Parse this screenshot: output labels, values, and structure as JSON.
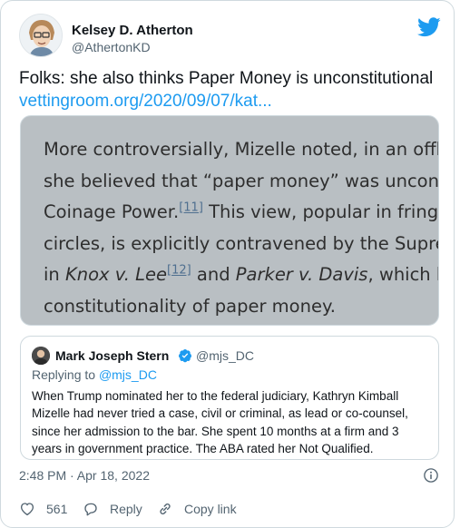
{
  "author": {
    "name": "Kelsey D. Atherton",
    "handle": "@AthertonKD"
  },
  "tweet": {
    "text": "Folks: she also thinks Paper Money is unconstitutional",
    "link": "vettingroom.org/2020/09/07/kat..."
  },
  "media": {
    "lines": [
      "More controversially, Mizelle noted, in an offhar",
      "she believed that “paper money” was unconstit",
      "Coinage Power.",
      "circles, is explicitly contravened by the Supremo",
      "in ",
      "constitutionality of paper money."
    ],
    "line3_fn": "[11]",
    "line3_rest": " This view, popular in fringe (",
    "line5_case1": "Knox v. Lee",
    "line5_fn": "[12]",
    "line5_mid": " and ",
    "line5_case2": "Parker v. Davis",
    "line5_rest": ", which have"
  },
  "quote": {
    "name": "Mark Joseph Stern",
    "handle": "@mjs_DC",
    "replying_prefix": "Replying to ",
    "replying_handle": "@mjs_DC",
    "text": "When Trump nominated her to the federal judiciary, Kathryn Kimball Mizelle had never tried a case, civil or criminal, as lead or co-counsel, since her admission to the bar. She spent 10 months at a firm and 3 years in government practice. The ABA rated her Not Qualified."
  },
  "meta": {
    "timestamp": "2:48 PM · Apr 18, 2022"
  },
  "actions": {
    "like_count": "561",
    "reply_label": "Reply",
    "copy_label": "Copy link"
  },
  "colors": {
    "accent": "#1d9bf0",
    "like": "#f91880",
    "muted": "#536471"
  }
}
